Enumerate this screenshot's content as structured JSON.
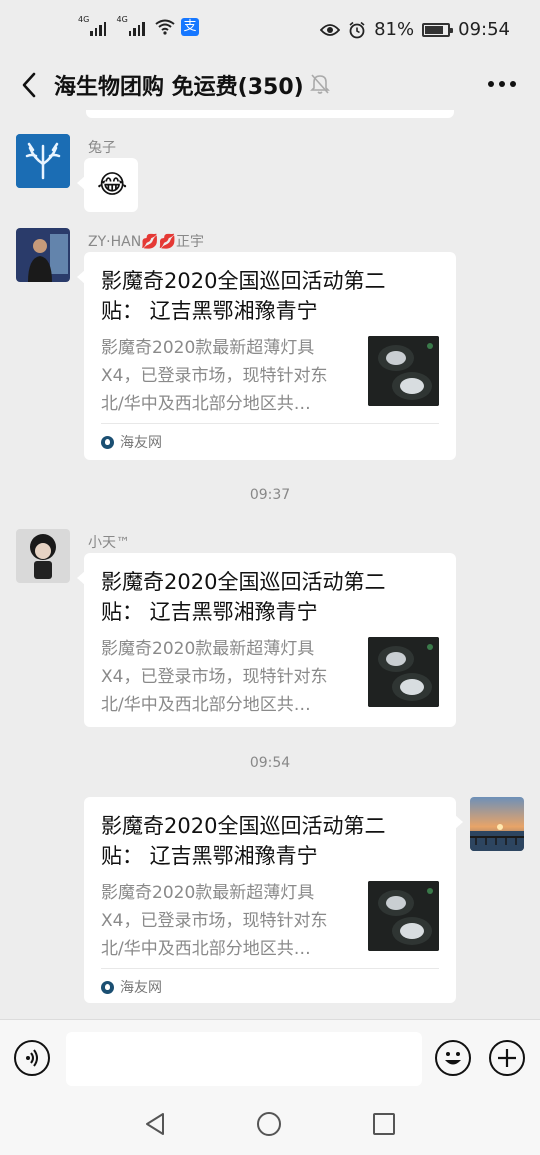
{
  "status_bar": {
    "signal1_tag": "4G",
    "signal2_tag": "4G",
    "alipay_char": "支",
    "battery_percent": "81%",
    "battery_level": 0.81,
    "time": "09:54"
  },
  "header": {
    "title": "海生物团购  免运费(350)",
    "icons": [
      "back-arrow-icon",
      "mute-bell-icon",
      "more-icon"
    ]
  },
  "messages": [
    {
      "sender": "兔子",
      "type": "emoji",
      "emoji": "😂"
    },
    {
      "sender": "ZY·HAN💋💋正宇",
      "type": "link",
      "title": "影魔奇2020全国巡回活动第二贴：  辽吉黑鄂湘豫青宁",
      "desc": "影魔奇2020款最新超薄灯具X4，已登录市场，现特针对东北/华中及西北部分地区共…",
      "source": "海友网"
    },
    {
      "time": "09:37"
    },
    {
      "sender": "小天™",
      "type": "link",
      "title": "影魔奇2020全国巡回活动第二贴：  辽吉黑鄂湘豫青宁",
      "desc": "影魔奇2020款最新超薄灯具X4，已登录市场，现特针对东北/华中及西北部分地区共…"
    },
    {
      "time": "09:54"
    },
    {
      "sender": "self",
      "type": "link",
      "title": "影魔奇2020全国巡回活动第二贴：  辽吉黑鄂湘豫青宁",
      "desc": "影魔奇2020款最新超薄灯具X4，已登录市场，现特针对东北/华中及西北部分地区共…",
      "source": "海友网"
    }
  ],
  "input_bar": {
    "value": "",
    "icons": [
      "voice-icon",
      "emoji-icon",
      "plus-icon"
    ]
  },
  "colors": {
    "background": "#ededed",
    "bubble": "#ffffff",
    "meta_text": "#888888"
  }
}
